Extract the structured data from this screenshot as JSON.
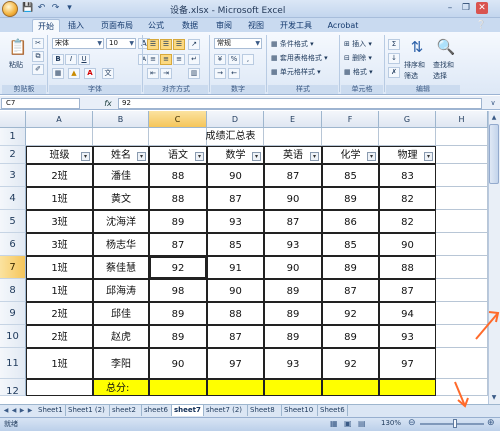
{
  "window": {
    "title": "设备.xlsx - Microsoft Excel",
    "qat_icons": [
      "save-icon",
      "undo-icon",
      "redo-icon",
      "customize-qat-icon"
    ]
  },
  "ribbon": {
    "tabs": [
      "开始",
      "插入",
      "页面布局",
      "公式",
      "数据",
      "审阅",
      "视图",
      "开发工具",
      "Acrobat"
    ],
    "active_tab": "开始",
    "clipboard": {
      "paste_label": "粘贴",
      "group_label": "剪贴板"
    },
    "font": {
      "font_name": "宋体",
      "font_size": "10",
      "bold": "B",
      "italic": "I",
      "underline": "U",
      "font_color_glyph": "A",
      "grow": "A",
      "shrink": "A",
      "group_label": "字体"
    },
    "alignment": {
      "group_label": "对齐方式"
    },
    "number": {
      "format": "常规",
      "currency": "%",
      "comma": ",",
      "group_label": "数字"
    },
    "styles": {
      "conditional": "条件格式",
      "table": "套用表格格式",
      "cell_style": "单元格样式",
      "group_label": "样式"
    },
    "cells": {
      "insert": "插入",
      "delete": "删除",
      "format": "格式",
      "group_label": "单元格"
    },
    "editing": {
      "sort": "排序和",
      "sort2": "筛选",
      "find": "查找和",
      "find2": "选择",
      "group_label": "编辑"
    }
  },
  "formula_bar": {
    "name_box": "C7",
    "fx": "fx",
    "value": "92"
  },
  "columns": [
    "A",
    "B",
    "C",
    "D",
    "E",
    "F",
    "G",
    "H"
  ],
  "active_column": "C",
  "active_row": "7",
  "rows": [
    "1",
    "2",
    "3",
    "4",
    "5",
    "6",
    "7",
    "8",
    "9",
    "10",
    "11",
    "12"
  ],
  "table": {
    "title": "成绩汇总表",
    "headers": [
      "班级",
      "姓名",
      "语文",
      "数学",
      "英语",
      "化学",
      "物理"
    ],
    "data": [
      [
        "2班",
        "潘佳",
        "88",
        "90",
        "87",
        "85",
        "83"
      ],
      [
        "1班",
        "黄文",
        "88",
        "87",
        "90",
        "89",
        "82"
      ],
      [
        "3班",
        "沈海洋",
        "89",
        "93",
        "87",
        "86",
        "82"
      ],
      [
        "3班",
        "杨志华",
        "87",
        "85",
        "93",
        "85",
        "90"
      ],
      [
        "1班",
        "蔡佳慧",
        "92",
        "91",
        "90",
        "89",
        "88"
      ],
      [
        "1班",
        "邱海涛",
        "98",
        "90",
        "89",
        "87",
        "87"
      ],
      [
        "2班",
        "邱佳",
        "89",
        "88",
        "89",
        "92",
        "94"
      ],
      [
        "2班",
        "赵虎",
        "89",
        "87",
        "89",
        "89",
        "93"
      ],
      [
        "1班",
        "李阳",
        "90",
        "97",
        "93",
        "92",
        "97"
      ]
    ],
    "total_label": "总分:"
  },
  "sheets": [
    "Sheet1",
    "Sheet1 (2)",
    "sheet2",
    "sheet6",
    "sheet7",
    "sheet7 (2)",
    "Sheet8",
    "Sheet10",
    "Sheet6"
  ],
  "active_sheet": "sheet7",
  "status": {
    "ready": "就绪",
    "zoom": "130%",
    "zoom_fraction": 0.55
  },
  "colors": {
    "accent": "#ffff00",
    "annotation": "#ff6a2a"
  }
}
